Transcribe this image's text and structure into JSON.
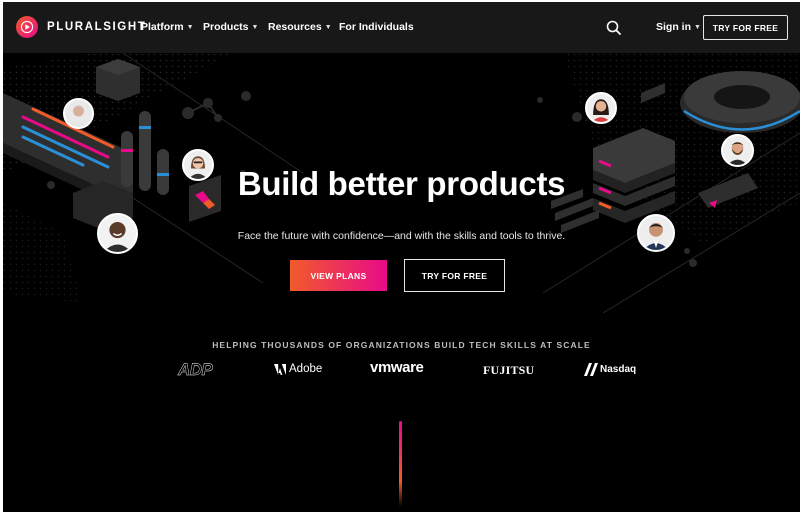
{
  "nav": {
    "brand": "PLURALSIGHT",
    "items": [
      {
        "label": "Platform",
        "has_dropdown": true
      },
      {
        "label": "Products",
        "has_dropdown": true
      },
      {
        "label": "Resources",
        "has_dropdown": true
      },
      {
        "label": "For Individuals",
        "has_dropdown": false
      }
    ],
    "search_icon": "search-icon",
    "signin_label": "Sign in",
    "try_label": "TRY FOR FREE"
  },
  "hero": {
    "headline": "Build better products",
    "subtitle": "Face the future with confidence—and with the skills and tools to thrive.",
    "primary_cta": "VIEW PLANS",
    "secondary_cta": "TRY FOR FREE"
  },
  "customers": {
    "heading": "HELPING THOUSANDS OF ORGANIZATIONS BUILD TECH SKILLS AT SCALE",
    "logos": [
      "ADP",
      "Adobe",
      "vmware",
      "FUJITSU",
      "Nasdaq"
    ]
  },
  "colors": {
    "accent_orange": "#f15b2a",
    "accent_pink": "#e80a89",
    "nav_bg": "#181818",
    "hero_bg": "#000000",
    "deco_blue": "#2a8fd6"
  }
}
